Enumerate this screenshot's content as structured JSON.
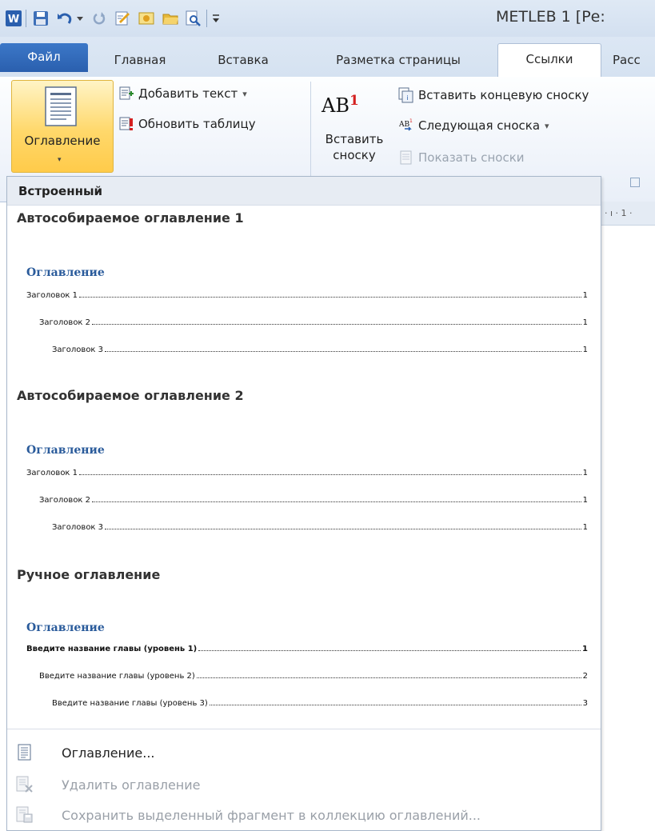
{
  "app": {
    "title": "METLEB 1 [Ре:"
  },
  "tabs": [
    {
      "label": "Файл"
    },
    {
      "label": "Главная"
    },
    {
      "label": "Вставка"
    },
    {
      "label": "Разметка страницы"
    },
    {
      "label": "Ссылки"
    },
    {
      "label": "Расс"
    }
  ],
  "ribbon": {
    "toc_button": {
      "label": "Оглавление",
      "arrow": "▾"
    },
    "add_text": {
      "label": "Добавить текст",
      "arrow": "▾"
    },
    "update_table": {
      "label": "Обновить таблицу"
    },
    "insert_footnote_icon_text": "AB",
    "insert_footnote_icon_sup": "1",
    "insert_footnote": {
      "line1": "Вставить",
      "line2": "сноску"
    },
    "insert_endnote": {
      "label": "Вставить концевую сноску"
    },
    "next_footnote": {
      "label": "Следующая сноска",
      "arrow": "▾"
    },
    "show_notes": {
      "label": "Показать сноски"
    }
  },
  "ruler_text": "· ı · 1 ·",
  "gallery": {
    "header": "Встроенный",
    "sections": [
      {
        "title": "Автособираемое оглавление 1",
        "toc_heading": "Оглавление",
        "rows": [
          {
            "text": "Заголовок 1",
            "page": "1"
          },
          {
            "text": "Заголовок 2",
            "page": "1"
          },
          {
            "text": "Заголовок 3",
            "page": "1"
          }
        ]
      },
      {
        "title": "Автособираемое оглавление 2",
        "toc_heading": "Оглавление",
        "rows": [
          {
            "text": "Заголовок 1",
            "page": "1"
          },
          {
            "text": "Заголовок 2",
            "page": "1"
          },
          {
            "text": "Заголовок 3",
            "page": "1"
          }
        ]
      },
      {
        "title": "Ручное оглавление",
        "toc_heading": "Оглавление",
        "rows": [
          {
            "text": "Введите название главы (уровень 1)",
            "page": "1"
          },
          {
            "text": "Введите название главы (уровень 2)",
            "page": "2"
          },
          {
            "text": "Введите название главы (уровень 3)",
            "page": "3"
          }
        ]
      }
    ],
    "menu": [
      {
        "label": "Оглавление...",
        "icon": "toc-doc-icon",
        "enabled": true
      },
      {
        "label": "Удалить оглавление",
        "icon": "remove-toc-icon",
        "enabled": false
      },
      {
        "label": "Сохранить выделенный фрагмент в коллекцию оглавлений...",
        "icon": "save-selection-icon",
        "enabled": false
      }
    ]
  },
  "colors": {
    "file_tab": "#2a5fae",
    "toc_heading": "#2a5b9b",
    "footnote_red": "#d42020",
    "highlight": "#ffd86b"
  }
}
